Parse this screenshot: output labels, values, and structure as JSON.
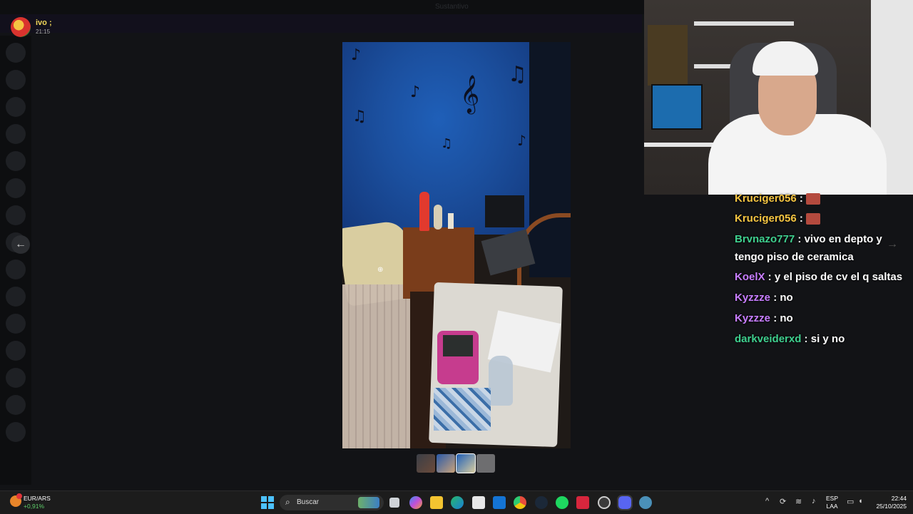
{
  "window": {
    "title": "Sustantivo"
  },
  "notification": {
    "name": "ivo ;",
    "time": "21:15"
  },
  "viewer": {
    "prev_icon": "arrow-left-icon",
    "next_icon": "arrow-right-icon",
    "thumbnails": 4,
    "active_thumbnail": 3
  },
  "stream_chat": {
    "messages": [
      {
        "user": "Kruciger056",
        "sep": " :",
        "text": "",
        "emote": true,
        "color": "#f5c542"
      },
      {
        "user": "Kruciger056",
        "sep": " :",
        "text": "",
        "emote": true,
        "color": "#f5c542"
      },
      {
        "user": "Brvnazo777",
        "sep": " :",
        "text": "vivo en depto y",
        "color": "#3ecf8e"
      },
      {
        "user": "",
        "sep": "",
        "text": "tengo piso de ceramica",
        "color": "#ffffff"
      },
      {
        "user": "KoelX",
        "sep": " :",
        "text": "y el piso de cv el q saltas",
        "color": "#c77dff"
      },
      {
        "user": "Kyzzze",
        "sep": " :",
        "text": "no",
        "color": "#c77dff"
      },
      {
        "user": "Kyzzze",
        "sep": " :",
        "text": "no",
        "color": "#c77dff"
      },
      {
        "user": "darkveiderxd",
        "sep": " :",
        "text": "si y no",
        "color": "#3ecf8e"
      }
    ]
  },
  "taskbar": {
    "ticker_pair": "EUR/ARS",
    "ticker_change": "+0,91%",
    "search_label": "Buscar",
    "language_top": "ESP",
    "language_bottom": "LAA",
    "time": "22:44",
    "date": "25/10/2025"
  },
  "colors": {
    "accent": "#4cc2ff",
    "notif_name": "#f0d75a",
    "ticker_up": "#5fcf6a"
  }
}
